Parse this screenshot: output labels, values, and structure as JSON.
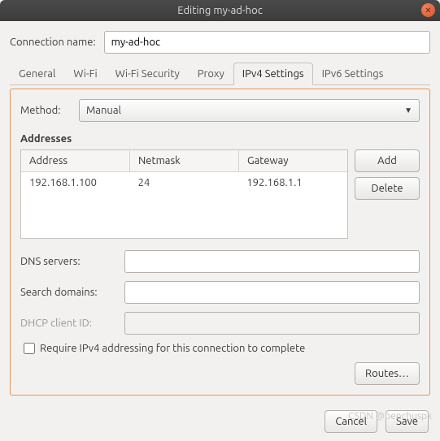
{
  "window": {
    "title": "Editing my-ad-hoc"
  },
  "connection": {
    "label": "Connection name:",
    "value": "my-ad-hoc"
  },
  "tabs": [
    "General",
    "Wi-Fi",
    "Wi-Fi Security",
    "Proxy",
    "IPv4 Settings",
    "IPv6 Settings"
  ],
  "active_tab": "IPv4 Settings",
  "method": {
    "label": "Method:",
    "value": "Manual"
  },
  "addresses": {
    "title": "Addresses",
    "columns": [
      "Address",
      "Netmask",
      "Gateway"
    ],
    "rows": [
      {
        "address": "192.168.1.100",
        "netmask": "24",
        "gateway": "192.168.1.1"
      }
    ],
    "add_label": "Add",
    "delete_label": "Delete"
  },
  "dns": {
    "label": "DNS servers:",
    "value": ""
  },
  "search": {
    "label": "Search domains:",
    "value": ""
  },
  "dhcp": {
    "label": "DHCP client ID:",
    "value": ""
  },
  "require": {
    "label": "Require IPv4 addressing for this connection to complete",
    "checked": false
  },
  "routes_label": "Routes…",
  "footer": {
    "cancel": "Cancel",
    "save": "Save"
  },
  "watermark": "CSDN @benchuspx"
}
